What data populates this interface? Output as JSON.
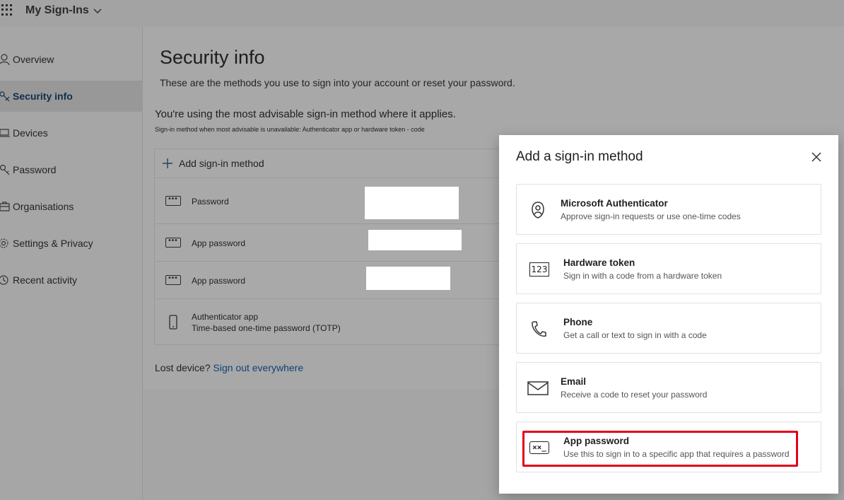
{
  "app": {
    "title": "My Sign-Ins"
  },
  "sidebar": {
    "items": [
      {
        "label": "Overview",
        "icon": "person-icon"
      },
      {
        "label": "Security info",
        "icon": "key-pen-icon",
        "active": true
      },
      {
        "label": "Devices",
        "icon": "laptop-icon"
      },
      {
        "label": "Password",
        "icon": "key-icon"
      },
      {
        "label": "Organisations",
        "icon": "briefcase-icon"
      },
      {
        "label": "Settings & Privacy",
        "icon": "gear-icon"
      },
      {
        "label": "Recent activity",
        "icon": "clock-icon"
      }
    ]
  },
  "main": {
    "title": "Security info",
    "subtitle": "These are the methods you use to sign into your account or reset your password.",
    "advisable": "You're using the most advisable sign-in method where it applies.",
    "advisable_sub": "Sign-in method when most advisable is unavailable: Authenticator app or hardware token - code",
    "add_method": "Add sign-in method",
    "methods": [
      {
        "label": "Password",
        "icon": "dots-icon"
      },
      {
        "label": "App password",
        "icon": "dots-icon"
      },
      {
        "label": "App password",
        "icon": "dots-icon"
      },
      {
        "label": "Authenticator app",
        "sublabel": "Time-based one-time password (TOTP)",
        "icon": "phone-icon"
      }
    ],
    "lost_device": "Lost device?",
    "sign_out_everywhere": "Sign out everywhere"
  },
  "modal": {
    "title": "Add a sign-in method",
    "options": [
      {
        "title": "Microsoft Authenticator",
        "desc": "Approve sign-in requests or use one-time codes",
        "icon": "authenticator-lock-icon"
      },
      {
        "title": "Hardware token",
        "desc": "Sign in with a code from a hardware token",
        "icon": "hardware-token-icon",
        "icon_text": "123"
      },
      {
        "title": "Phone",
        "desc": "Get a call or text to sign in with a code",
        "icon": "phone-handset-icon"
      },
      {
        "title": "Email",
        "desc": "Receive a code to reset your password",
        "icon": "envelope-icon"
      },
      {
        "title": "App password",
        "desc": "Use this to sign in to a specific app that requires a password",
        "icon": "app-password-icon",
        "icon_text": "××_",
        "highlighted": true
      }
    ]
  },
  "colors": {
    "highlight": "#e3001b",
    "link": "#0f4275"
  }
}
